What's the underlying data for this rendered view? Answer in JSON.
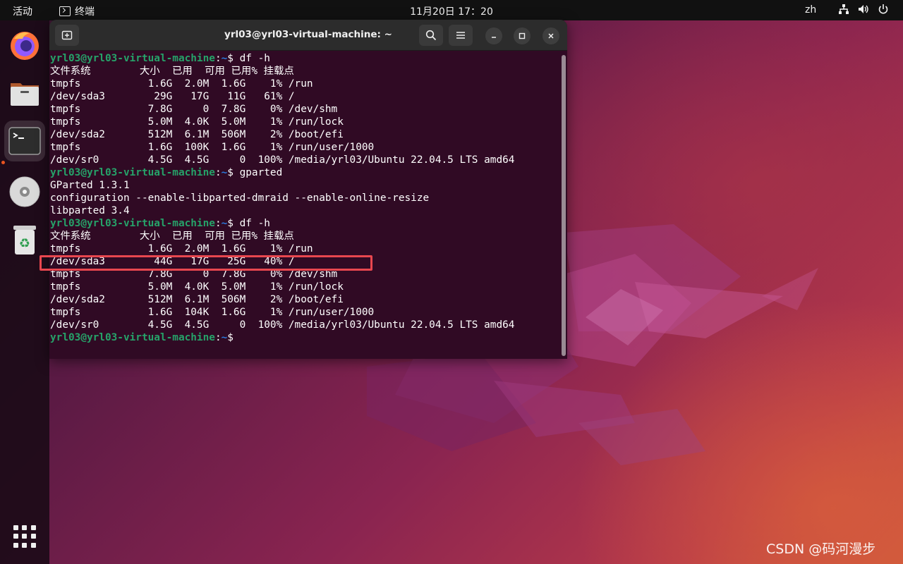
{
  "topbar": {
    "activities": "活动",
    "app_name": "终端",
    "clock": "11月20日  17：20",
    "language": "zh",
    "tray_icons": [
      "network-icon",
      "volume-icon",
      "power-icon"
    ]
  },
  "dock": {
    "items": [
      "firefox-icon",
      "files-icon",
      "terminal-icon",
      "disc-icon",
      "trash-icon"
    ],
    "apps_grid": "show-applications-icon"
  },
  "terminal": {
    "title": "yrl03@yrl03-virtual-machine: ~",
    "prompt_user": "yrl03@yrl03-virtual-machine",
    "prompt_path": "~",
    "lines": [
      {
        "type": "prompt",
        "cmd": "$ df -h"
      },
      {
        "type": "out",
        "text": "文件系统        大小  已用  可用 已用% 挂载点"
      },
      {
        "type": "out",
        "text": "tmpfs           1.6G  2.0M  1.6G    1% /run"
      },
      {
        "type": "out",
        "text": "/dev/sda3        29G   17G   11G   61% /"
      },
      {
        "type": "out",
        "text": "tmpfs           7.8G     0  7.8G    0% /dev/shm"
      },
      {
        "type": "out",
        "text": "tmpfs           5.0M  4.0K  5.0M    1% /run/lock"
      },
      {
        "type": "out",
        "text": "/dev/sda2       512M  6.1M  506M    2% /boot/efi"
      },
      {
        "type": "out",
        "text": "tmpfs           1.6G  100K  1.6G    1% /run/user/1000"
      },
      {
        "type": "out",
        "text": "/dev/sr0        4.5G  4.5G     0  100% /media/yrl03/Ubuntu 22.04.5 LTS amd64"
      },
      {
        "type": "prompt",
        "cmd": "$ gparted"
      },
      {
        "type": "out",
        "text": "GParted 1.3.1"
      },
      {
        "type": "out",
        "text": "configuration --enable-libparted-dmraid --enable-online-resize"
      },
      {
        "type": "out",
        "text": "libparted 3.4"
      },
      {
        "type": "prompt",
        "cmd": "$ df -h"
      },
      {
        "type": "out",
        "text": "文件系统        大小  已用  可用 已用% 挂载点"
      },
      {
        "type": "out",
        "text": "tmpfs           1.6G  2.0M  1.6G    1% /run"
      },
      {
        "type": "out",
        "text": "/dev/sda3        44G   17G   25G   40% /"
      },
      {
        "type": "out",
        "text": "tmpfs           7.8G     0  7.8G    0% /dev/shm"
      },
      {
        "type": "out",
        "text": "tmpfs           5.0M  4.0K  5.0M    1% /run/lock"
      },
      {
        "type": "out",
        "text": "/dev/sda2       512M  6.1M  506M    2% /boot/efi"
      },
      {
        "type": "out",
        "text": "tmpfs           1.6G  104K  1.6G    1% /run/user/1000"
      },
      {
        "type": "out",
        "text": "/dev/sr0        4.5G  4.5G     0  100% /media/yrl03/Ubuntu 22.04.5 LTS amd64"
      },
      {
        "type": "prompt",
        "cmd": "$"
      }
    ]
  },
  "watermark": "CSDN @码河漫步",
  "colors": {
    "terminal_bg": "#300a24",
    "prompt_user": "#26a269",
    "prompt_path": "#2a7bde",
    "highlight": "#e8474f",
    "running_indicator": "#e95420"
  }
}
